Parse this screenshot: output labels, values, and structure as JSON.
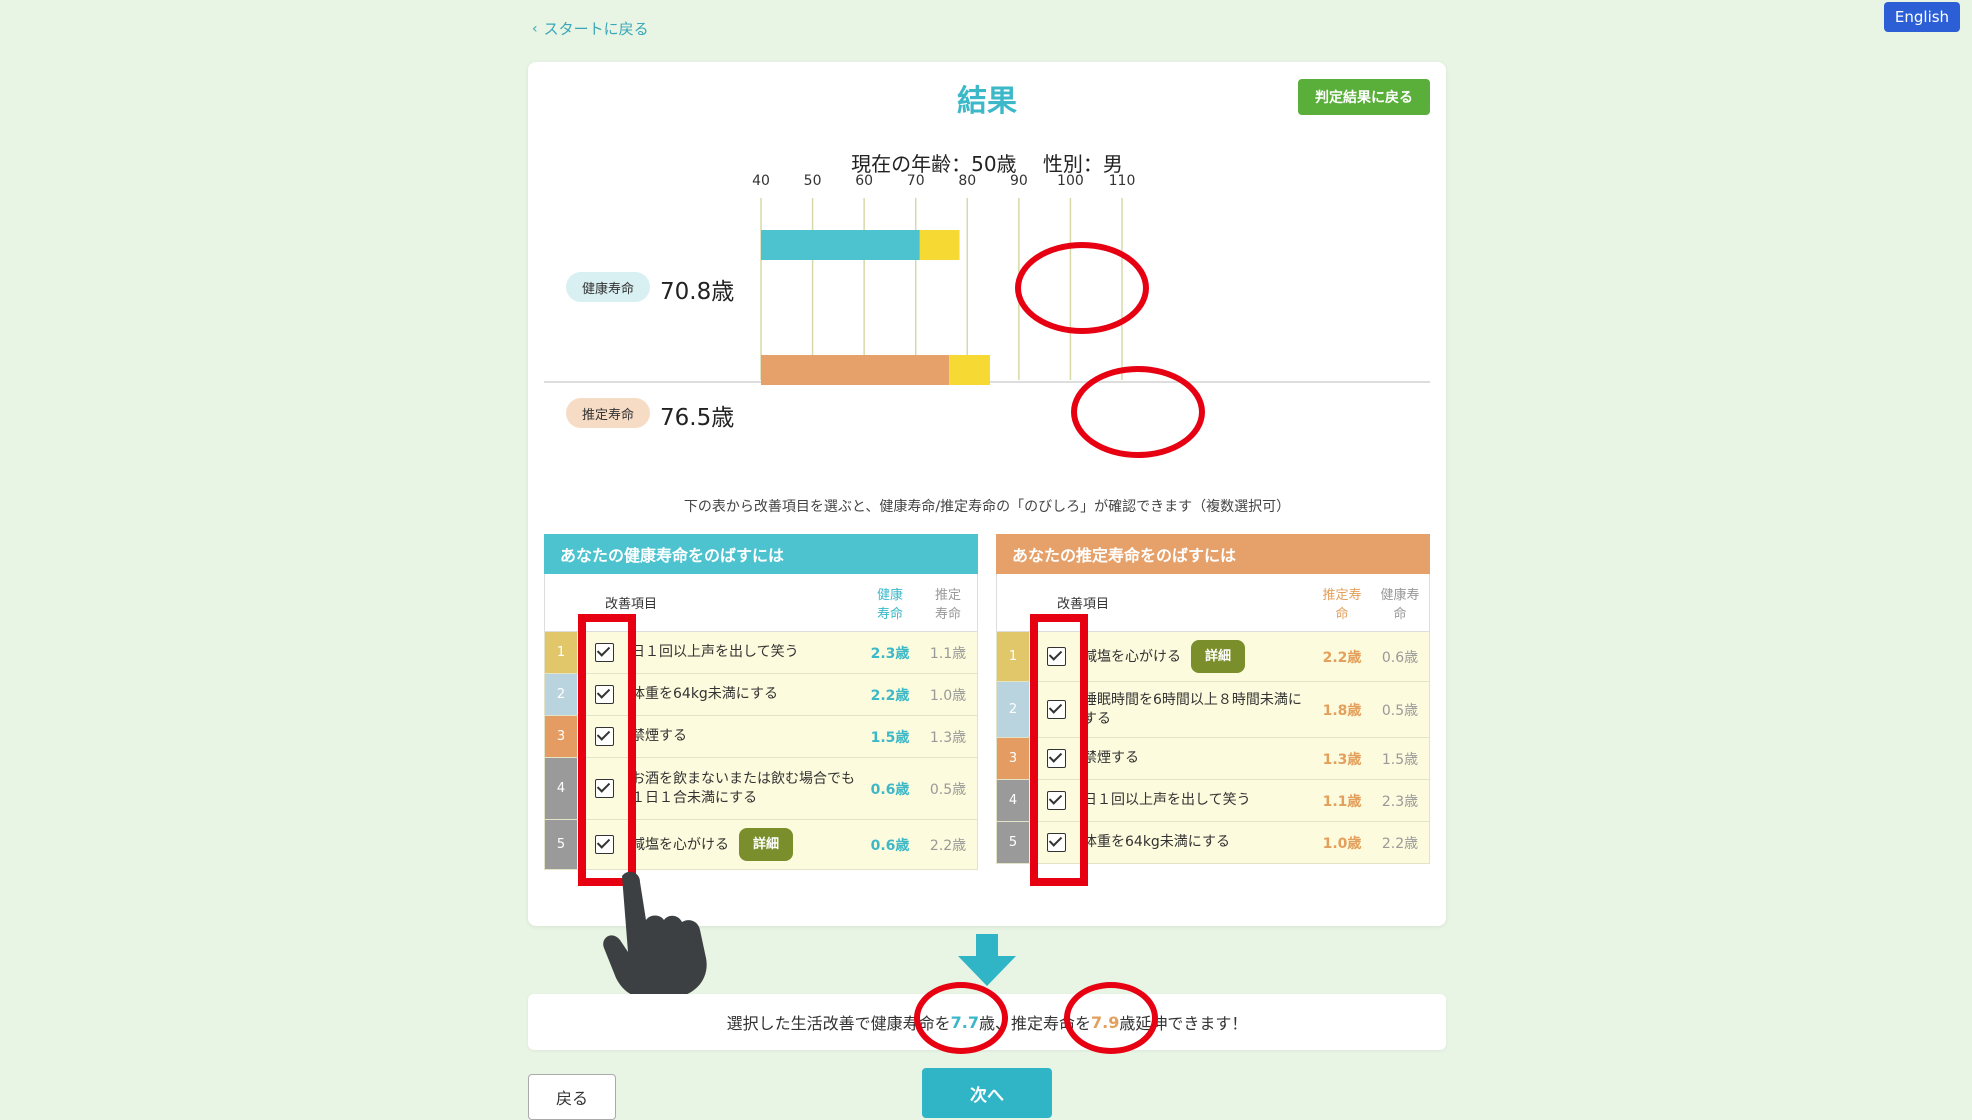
{
  "nav": {
    "back_to_start": "スタートに戻る",
    "language_button": "English"
  },
  "card": {
    "title": "結果",
    "judge_button": "判定結果に戻る",
    "age_label": "現在の年齢：50歳　 性別：男",
    "hint": "下の表から改善項目を選ぶと、健康寿命/推定寿命の「のびしろ」が確認できます（複数選択可）"
  },
  "chart_data": {
    "type": "bar",
    "orientation": "horizontal",
    "x_ticks": [
      "40",
      "50",
      "60",
      "70",
      "80",
      "90",
      "100",
      "110"
    ],
    "xlim": [
      40,
      110
    ],
    "bars": [
      {
        "label": "健康寿命",
        "value_text": "70.8歳",
        "value": 70.8,
        "extension_to": 78.5,
        "color": "#4cc3cf",
        "extension_color": "#f7d934",
        "pill_color": "#d8f0f2"
      },
      {
        "label": "推定寿命",
        "value_text": "76.5歳",
        "value": 76.5,
        "extension_to": 84.4,
        "color": "#e6a16a",
        "extension_color": "#f7d934",
        "pill_color": "#f7dcc5"
      }
    ]
  },
  "tables": [
    {
      "title": "あなたの健康寿命をのばすには",
      "header_color": "#4cc3cf",
      "value_color": "#3cb8c8",
      "col_item": "改善項目",
      "col_v1": "健康\n寿命",
      "col_v2": "推定\n寿命",
      "rows": [
        {
          "num": "1",
          "num_color": "#e2c66a",
          "label": "日１回以上声を出して笑う",
          "v1": "2.3歳",
          "v2": "1.1歳",
          "detail": ""
        },
        {
          "num": "2",
          "num_color": "#b9d4df",
          "label": "体重を64kg未満にする",
          "v1": "2.2歳",
          "v2": "1.0歳",
          "detail": ""
        },
        {
          "num": "3",
          "num_color": "#e59c62",
          "label": "禁煙する",
          "v1": "1.5歳",
          "v2": "1.3歳",
          "detail": ""
        },
        {
          "num": "4",
          "num_color": "#9a9a9a",
          "label": "お酒を飲まないまたは飲む場合でも１日１合未満にする",
          "v1": "0.6歳",
          "v2": "0.5歳",
          "detail": ""
        },
        {
          "num": "5",
          "num_color": "#9a9a9a",
          "label": "減塩を心がける",
          "v1": "0.6歳",
          "v2": "2.2歳",
          "detail": "詳細"
        }
      ]
    },
    {
      "title": "あなたの推定寿命をのばすには",
      "header_color": "#e6a16a",
      "value_color": "#e3a05c",
      "col_item": "改善項目",
      "col_v1": "推定寿\n命",
      "col_v2": "健康寿\n命",
      "rows": [
        {
          "num": "1",
          "num_color": "#e2c66a",
          "label": "減塩を心がける",
          "v1": "2.2歳",
          "v2": "0.6歳",
          "detail": "詳細"
        },
        {
          "num": "2",
          "num_color": "#b9d4df",
          "label": "睡眠時間を6時間以上８時間未満にする",
          "v1": "1.8歳",
          "v2": "0.5歳",
          "detail": ""
        },
        {
          "num": "3",
          "num_color": "#e59c62",
          "label": "禁煙する",
          "v1": "1.3歳",
          "v2": "1.5歳",
          "detail": ""
        },
        {
          "num": "4",
          "num_color": "#9a9a9a",
          "label": "日１回以上声を出して笑う",
          "v1": "1.1歳",
          "v2": "2.3歳",
          "detail": ""
        },
        {
          "num": "5",
          "num_color": "#9a9a9a",
          "label": "体重を64kg未満にする",
          "v1": "1.0歳",
          "v2": "2.2歳",
          "detail": ""
        }
      ]
    }
  ],
  "result": {
    "prefix": "選択した生活改善で健康寿命を",
    "health_gain": "7.7",
    "middle": "歳、推定寿命を",
    "life_gain": "7.9",
    "suffix": "歳延伸できます！"
  },
  "footer": {
    "back_button": "戻る",
    "next_button": "次へ"
  },
  "colors": {
    "annotation_red": "#e60012",
    "accent_teal": "#2fb5c6"
  }
}
